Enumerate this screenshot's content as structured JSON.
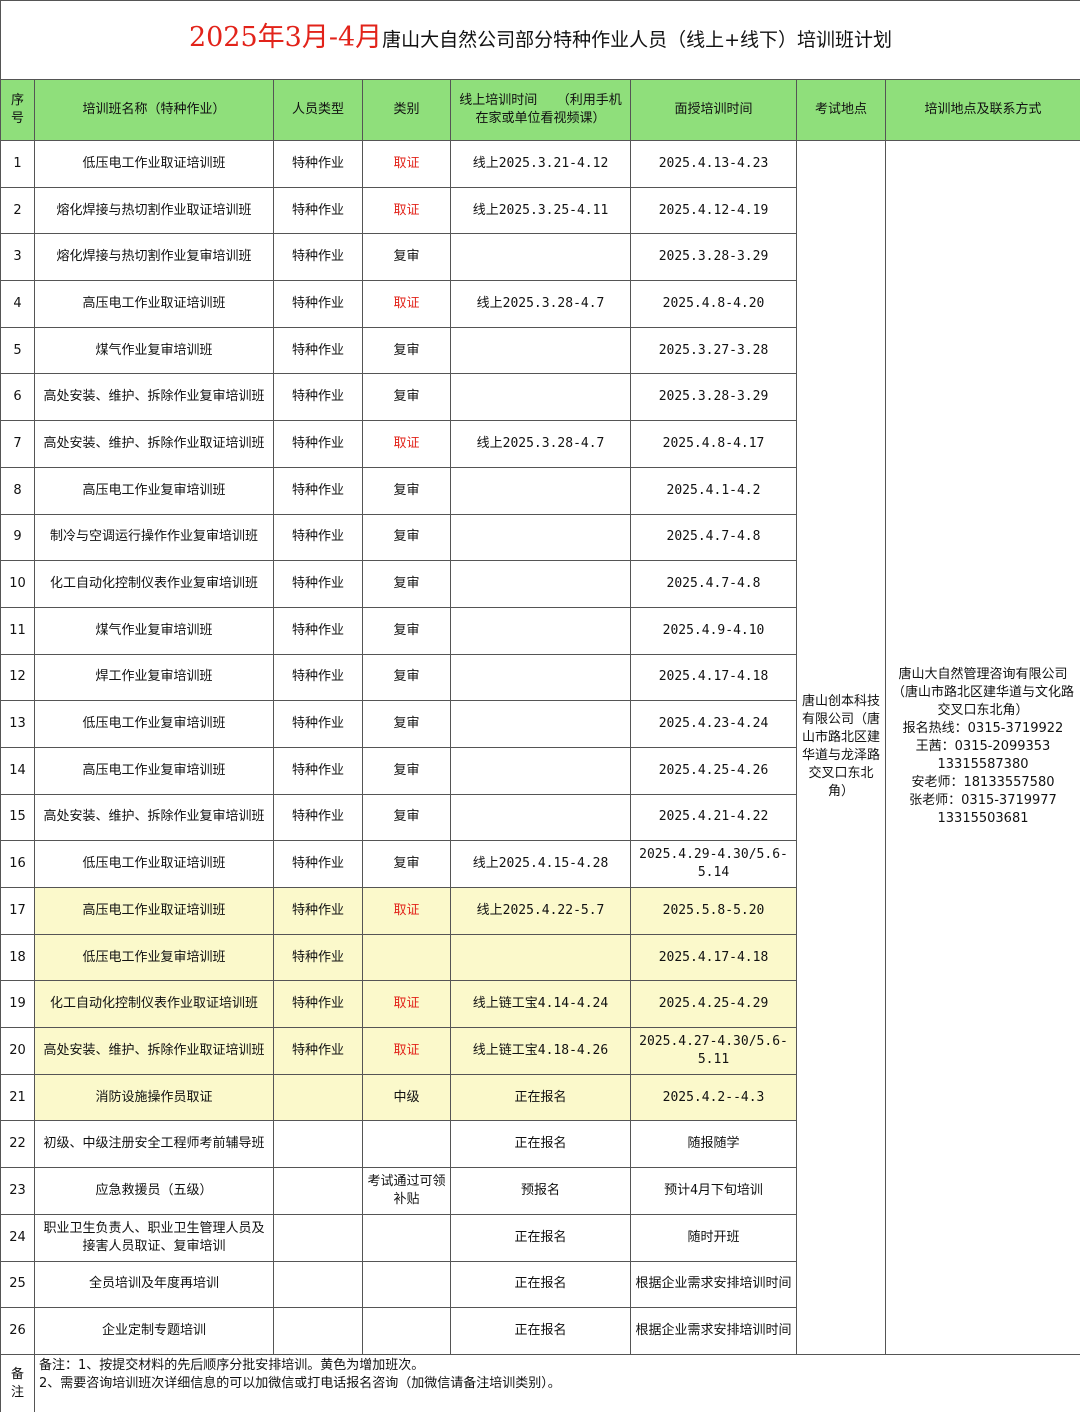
{
  "title": {
    "main": "2025年3月-4月",
    "sub": "唐山大自然公司部分特种作业人员（线上+线下）培训班计划"
  },
  "headers": [
    "序号",
    "培训班名称（特种作业）",
    "人员类型",
    "类别",
    "线上培训时间　　（利用手机在家或单位看视频课）",
    "面授培训时间",
    "考试地点",
    "培训地点及联系方式"
  ],
  "rows": [
    {
      "no": "1",
      "name": "低压电工作业取证培训班",
      "ptype": "特种作业",
      "cat": "取证",
      "online": "线上2025.3.21-4.12",
      "offline": "2025.4.13-4.23"
    },
    {
      "no": "2",
      "name": "熔化焊接与热切割作业取证培训班",
      "ptype": "特种作业",
      "cat": "取证",
      "online": "线上2025.3.25-4.11",
      "offline": "2025.4.12-4.19"
    },
    {
      "no": "3",
      "name": "熔化焊接与热切割作业复审培训班",
      "ptype": "特种作业",
      "cat": "复审",
      "online": "",
      "offline": "2025.3.28-3.29"
    },
    {
      "no": "4",
      "name": "高压电工作业取证培训班",
      "ptype": "特种作业",
      "cat": "取证",
      "online": "线上2025.3.28-4.7",
      "offline": "2025.4.8-4.20"
    },
    {
      "no": "5",
      "name": "煤气作业复审培训班",
      "ptype": "特种作业",
      "cat": "复审",
      "online": "",
      "offline": "2025.3.27-3.28"
    },
    {
      "no": "6",
      "name": "高处安装、维护、拆除作业复审培训班",
      "ptype": "特种作业",
      "cat": "复审",
      "online": "",
      "offline": "2025.3.28-3.29"
    },
    {
      "no": "7",
      "name": "高处安装、维护、拆除作业取证培训班",
      "ptype": "特种作业",
      "cat": "取证",
      "online": "线上2025.3.28-4.7",
      "offline": "2025.4.8-4.17"
    },
    {
      "no": "8",
      "name": "高压电工作业复审培训班",
      "ptype": "特种作业",
      "cat": "复审",
      "online": "",
      "offline": "2025.4.1-4.2"
    },
    {
      "no": "9",
      "name": "制冷与空调运行操作作业复审培训班",
      "ptype": "特种作业",
      "cat": "复审",
      "online": "",
      "offline": "2025.4.7-4.8"
    },
    {
      "no": "10",
      "name": "化工自动化控制仪表作业复审培训班",
      "ptype": "特种作业",
      "cat": "复审",
      "online": "",
      "offline": "2025.4.7-4.8"
    },
    {
      "no": "11",
      "name": "煤气作业复审培训班",
      "ptype": "特种作业",
      "cat": "复审",
      "online": "",
      "offline": "2025.4.9-4.10"
    },
    {
      "no": "12",
      "name": "焊工作业复审培训班",
      "ptype": "特种作业",
      "cat": "复审",
      "online": "",
      "offline": "2025.4.17-4.18"
    },
    {
      "no": "13",
      "name": "低压电工作业复审培训班",
      "ptype": "特种作业",
      "cat": "复审",
      "online": "",
      "offline": "2025.4.23-4.24"
    },
    {
      "no": "14",
      "name": "高压电工作业复审培训班",
      "ptype": "特种作业",
      "cat": "复审",
      "online": "",
      "offline": "2025.4.25-4.26"
    },
    {
      "no": "15",
      "name": "高处安装、维护、拆除作业复审培训班",
      "ptype": "特种作业",
      "cat": "复审",
      "online": "",
      "offline": "2025.4.21-4.22"
    },
    {
      "no": "16",
      "name": "低压电工作业取证培训班",
      "ptype": "特种作业",
      "cat": "复审",
      "online": "线上2025.4.15-4.28",
      "offline": "2025.4.29-4.30/5.6-5.14"
    },
    {
      "no": "17",
      "name": "高压电工作业取证培训班",
      "ptype": "特种作业",
      "cat": "取证",
      "online": "线上2025.4.22-5.7",
      "offline": "2025.5.8-5.20"
    },
    {
      "no": "18",
      "name": "低压电工作业复审培训班",
      "ptype": "特种作业",
      "cat": "",
      "online": "",
      "offline": "2025.4.17-4.18"
    },
    {
      "no": "19",
      "name": "化工自动化控制仪表作业取证培训班",
      "ptype": "特种作业",
      "cat": "取证",
      "online": "线上链工宝4.14-4.24",
      "offline": "2025.4.25-4.29"
    },
    {
      "no": "20",
      "name": "高处安装、维护、拆除作业取证培训班",
      "ptype": "特种作业",
      "cat": "取证",
      "online": "线上链工宝4.18-4.26",
      "offline": "2025.4.27-4.30/5.6-5.11"
    },
    {
      "no": "21",
      "name": "消防设施操作员取证",
      "ptype": "",
      "cat": "中级",
      "online": "正在报名",
      "offline": "2025.4.2--4.3"
    },
    {
      "no": "22",
      "name": "初级、中级注册安全工程师考前辅导班",
      "ptype": "",
      "cat": "",
      "online": "正在报名",
      "offline": "随报随学"
    },
    {
      "no": "23",
      "name": "应急救援员（五级）",
      "ptype": "",
      "cat": "考试通过可领补贴",
      "online": "预报名",
      "offline": "预计4月下旬培训"
    },
    {
      "no": "24",
      "name": "职业卫生负责人、职业卫生管理人员及接害人员取证、复审培训",
      "ptype": "",
      "cat": "",
      "online": "正在报名",
      "offline": "随时开班"
    },
    {
      "no": "25",
      "name": "全员培训及年度再培训",
      "ptype": "",
      "cat": "",
      "online": "正在报名",
      "offline": "根据企业需求安排培训时间"
    },
    {
      "no": "26",
      "name": "企业定制专题培训",
      "ptype": "",
      "cat": "",
      "online": "正在报名",
      "offline": "根据企业需求安排培训时间"
    }
  ],
  "exam_location": "唐山创本科技有限公司（唐山市路北区建华道与龙泽路交叉口东北角）",
  "training_location": {
    "company": "唐山大自然管理咨询有限公司（唐山市路北区建华道与文化路交叉口东北角）",
    "hotline": "报名热线：0315-3719922",
    "wang": "王茜：0315-2099353",
    "wang_mobile": "13315587380",
    "an": "安老师：18133557580",
    "zhang": "张老师：0315-3719977",
    "zhang_mobile": "13315503681"
  },
  "note": {
    "label": "备注",
    "line1": "备注：1、按提交材料的先后顺序分批安排培训。黄色为增加班次。",
    "line2": "2、需要咨询培训班次详细信息的可以加微信或打电话报名咨询（加微信请备注培训类别）。"
  },
  "highlight_color": "#fbf9cb",
  "header_color": "#8fdf7b",
  "accent_red": "#e2231a"
}
